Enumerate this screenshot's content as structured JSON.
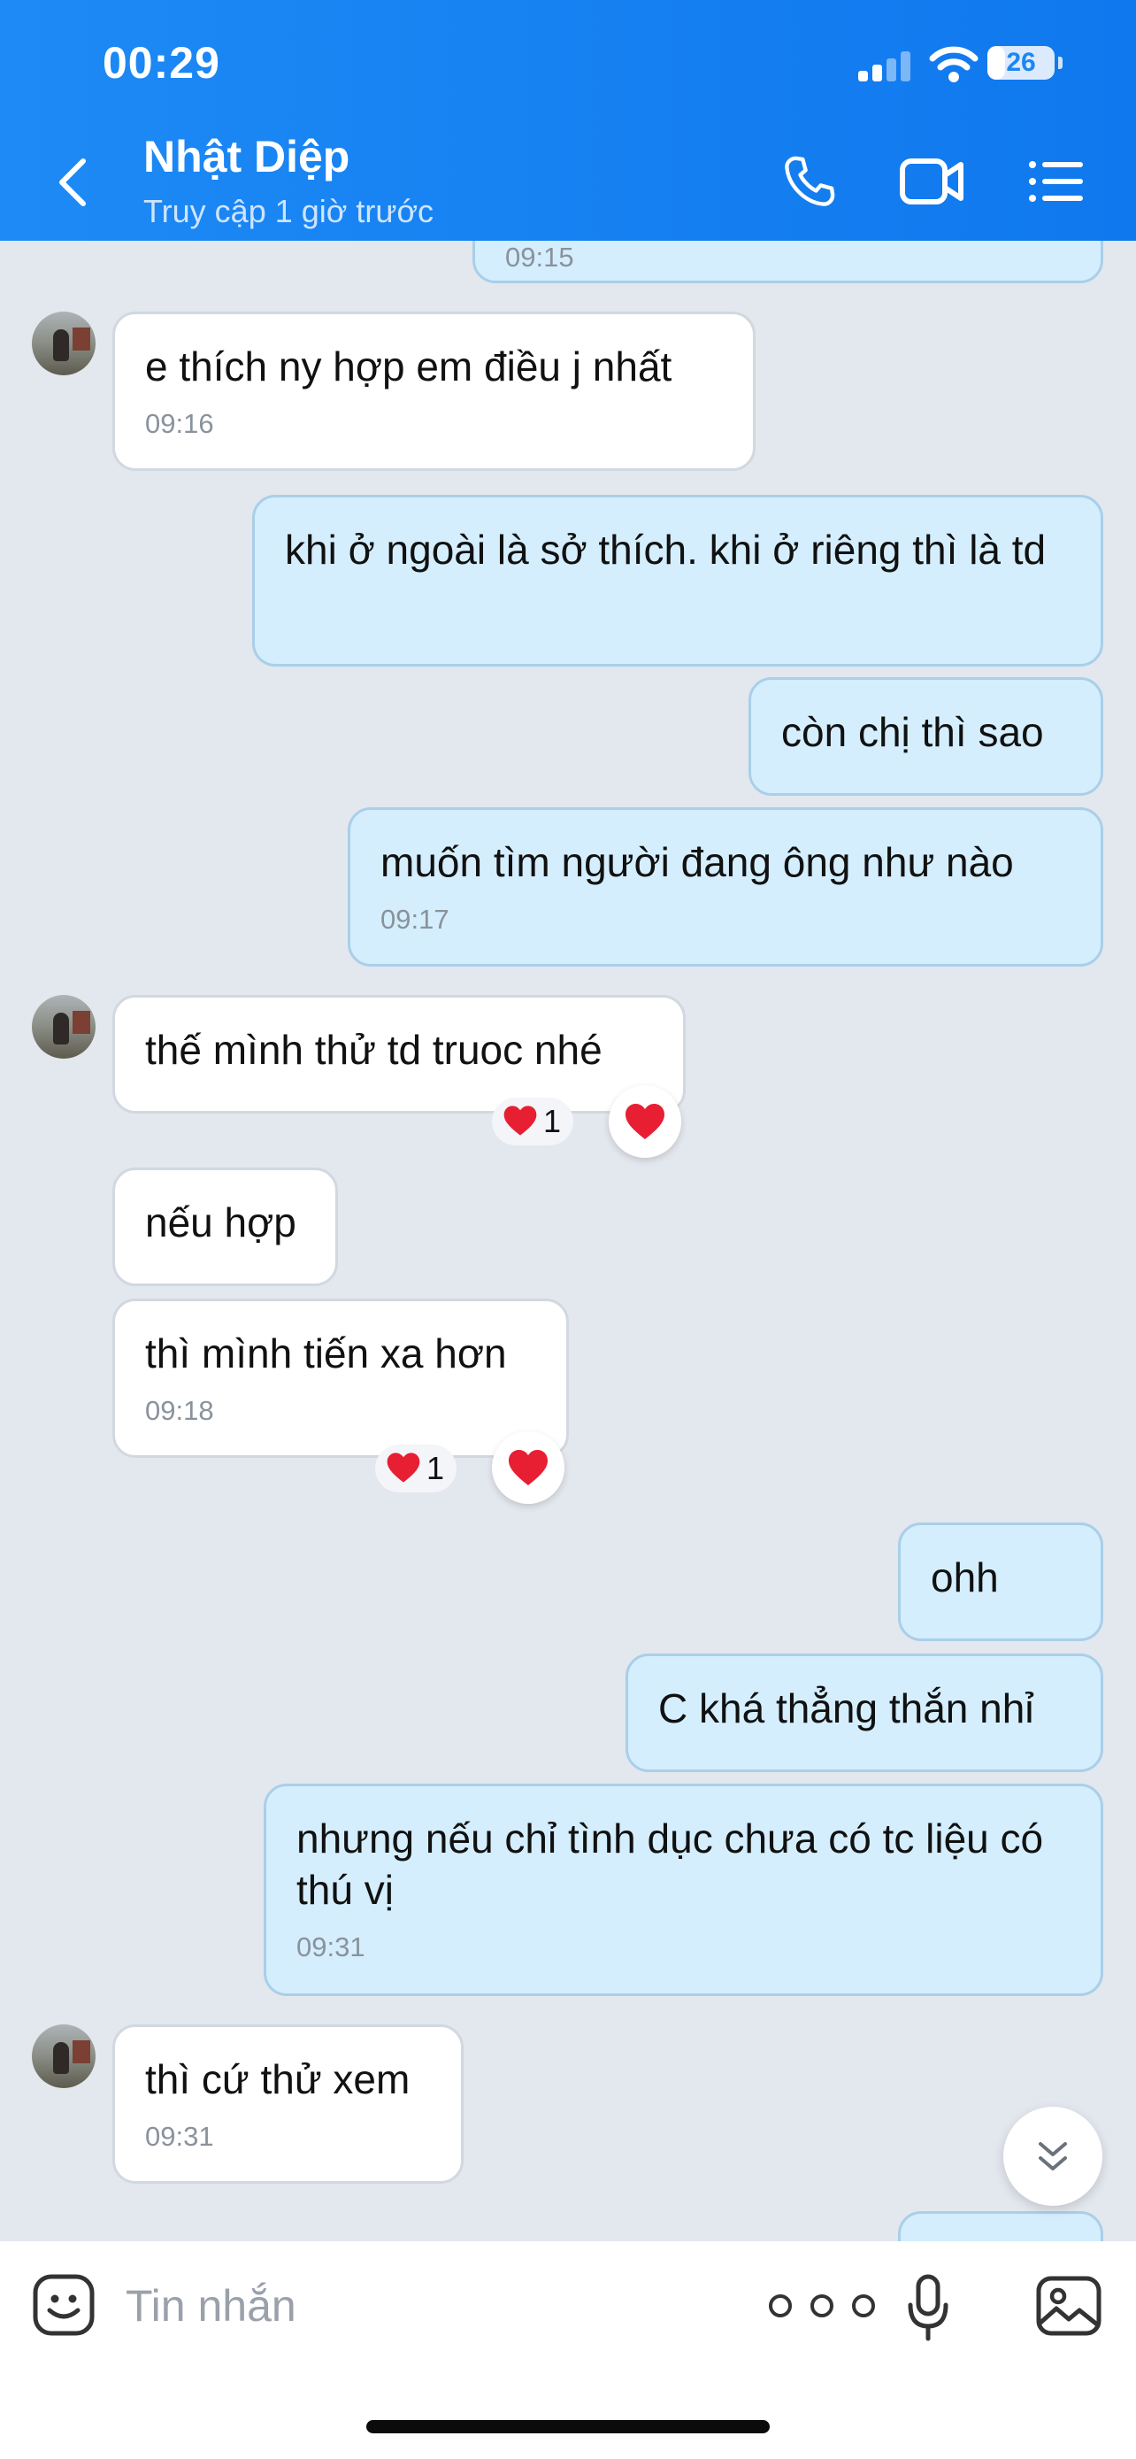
{
  "status_bar": {
    "time": "00:29",
    "battery": "26",
    "battery_level_percent": 26
  },
  "header": {
    "contact_name": "Nhật Diệp",
    "contact_status": "Truy cập 1 giờ trước",
    "icons": [
      "back-icon",
      "phone-icon",
      "video-call-icon",
      "menu-list-icon"
    ]
  },
  "messages": [
    {
      "side": "out",
      "text": "",
      "time": "09:15",
      "partial": true
    },
    {
      "side": "in",
      "text": "e thích ny hợp em điều j nhất",
      "time": "09:16"
    },
    {
      "side": "out",
      "text": "khi ở ngoài là sở thích. khi ở riêng thì là td"
    },
    {
      "side": "out",
      "text": "còn chị thì sao"
    },
    {
      "side": "out",
      "text": "muốn tìm người đang ông như nào",
      "time": "09:17"
    },
    {
      "side": "in",
      "text": "thế mình thử td truoc nhé",
      "reaction": {
        "icon": "heart-icon",
        "count": "1"
      }
    },
    {
      "side": "in",
      "text": "nếu hợp"
    },
    {
      "side": "in",
      "text": "thì mình tiến xa hơn",
      "time": "09:18",
      "reaction": {
        "icon": "heart-icon",
        "count": "1"
      }
    },
    {
      "side": "out",
      "text": "ohh"
    },
    {
      "side": "out",
      "text": "C khá thẳng thắn nhỉ"
    },
    {
      "side": "out",
      "text": "nhưng nếu chỉ tình dục chưa có tc liệu có thú vị",
      "time": "09:31"
    },
    {
      "side": "in",
      "text": "thì cứ thử xem",
      "time": "09:31"
    },
    {
      "side": "out",
      "text": "",
      "partial": true
    }
  ],
  "input_bar": {
    "placeholder": "Tin nhắn",
    "icons": [
      "emoji-icon",
      "more-options-icon",
      "microphone-icon",
      "image-icon"
    ]
  },
  "colors": {
    "header": "#1a86f3",
    "background": "#e3e7ee",
    "incoming_bubble": "#ffffff",
    "outgoing_bubble": "#d4eefd",
    "reaction_heart": "#e81e32"
  }
}
